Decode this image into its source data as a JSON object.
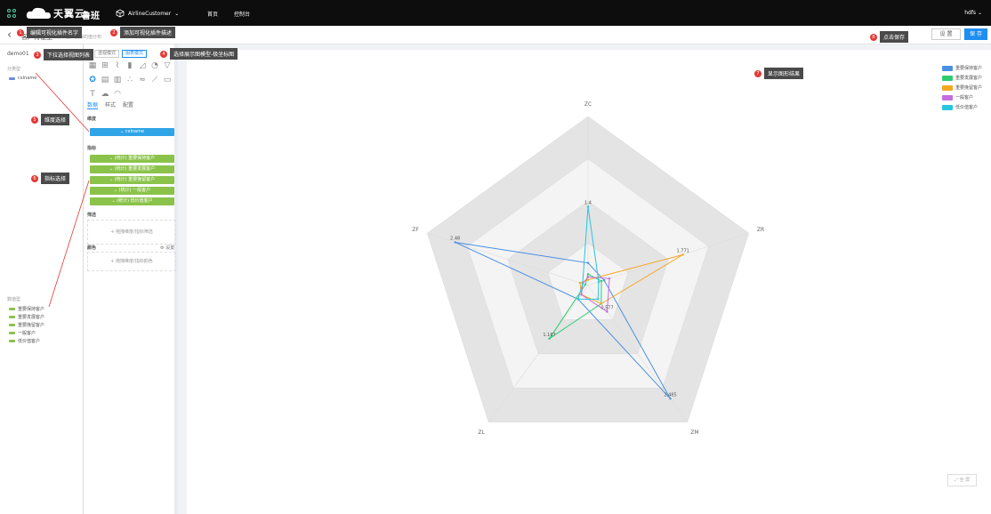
{
  "topbar": {
    "brand": "天翼云",
    "brand_sub": "e Cloud",
    "product": "鲁班",
    "project": "AirlineCustomer",
    "nav_home": "首页",
    "nav_console": "控制台",
    "user": "hdfs"
  },
  "header": {
    "title": "客户特征型",
    "description": "客户获得的值分布",
    "settings_label": "设 置",
    "save_label": "保 存"
  },
  "left": {
    "dataset": "demo01",
    "dim_title": "分类型",
    "dimensions": [
      "cxlname"
    ],
    "ind_title": "数值型",
    "indicators": [
      "重要保持客户",
      "重要发展客户",
      "重要挽留客户",
      "一般客户",
      "低价值客户"
    ]
  },
  "config": {
    "toggle_list": "透视模式",
    "toggle_chart": "图表模式",
    "tabs": [
      "数据",
      "样式",
      "配置"
    ],
    "dim_label": "维度",
    "dim_value": "cxlname",
    "ind_label": "指标",
    "indicators": [
      "(统计) 重要保持客户",
      "(统计) 重要发展客户",
      "(统计) 重要挽留客户",
      "(统计) 一般客户",
      "(统计) 低价值客户"
    ],
    "filter_label": "筛选",
    "filter_hint": "+ 拖拽维度/指标筛选",
    "color_label": "颜色",
    "color_settings": "设置",
    "color_hint": "+ 拖拽维度/指标颜色"
  },
  "legend": [
    {
      "name": "重要保持客户",
      "color": "#4a90e2"
    },
    {
      "name": "重要发展客户",
      "color": "#2ecc71"
    },
    {
      "name": "重要挽留客户",
      "color": "#f5a623"
    },
    {
      "name": "一般客户",
      "color": "#c36ee0"
    },
    {
      "name": "低价值客户",
      "color": "#29c4e0"
    }
  ],
  "fullscreen_label": "全 屏",
  "annotations": [
    "编辑可视化插件名字",
    "添加可视化插件描述",
    "下拉选择视图列表",
    "选择展示图模型-极坐标图",
    "维度选择",
    "指标选择",
    "显示图形结果",
    "点击保存"
  ],
  "chart_data": {
    "type": "radar",
    "axes": [
      "ZC",
      "ZR",
      "ZM",
      "ZL",
      "ZF"
    ],
    "max": 3,
    "series": [
      {
        "name": "重要保持客户",
        "values": [
          0.4,
          0.3,
          2.485,
          0.3,
          2.48
        ]
      },
      {
        "name": "重要发展客户",
        "values": [
          0.2,
          0.25,
          0.4,
          1.167,
          0.05
        ]
      },
      {
        "name": "重要挽留客户",
        "values": [
          0.1,
          1.771,
          0.4,
          0.2,
          0.15
        ]
      },
      {
        "name": "一般客户",
        "values": [
          0.15,
          0.4,
          0.577,
          0.2,
          0.1
        ]
      },
      {
        "name": "低价值客户",
        "values": [
          1.4,
          0.2,
          0.3,
          0.3,
          0.1
        ]
      }
    ],
    "point_labels": [
      "2.48",
      "1.771",
      "1.167",
      "2.485",
      "0.577",
      "1.4"
    ]
  }
}
